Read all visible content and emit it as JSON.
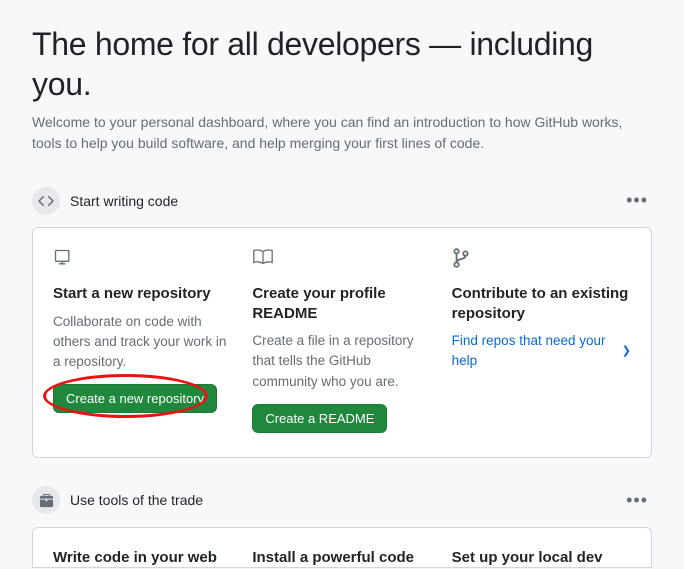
{
  "hero": {
    "title": "The home for all developers — including you.",
    "subtitle": "Welcome to your personal dashboard, where you can find an introduction to how GitHub works, tools to help you build software, and help merging your first lines of code."
  },
  "section1": {
    "title": "Start writing code",
    "cards": [
      {
        "title": "Start a new repository",
        "desc": "Collaborate on code with others and track your work in a repository.",
        "button": "Create a new repository"
      },
      {
        "title": "Create your profile README",
        "desc": "Create a file in a repository that tells the GitHub community who you are.",
        "button": "Create a README"
      },
      {
        "title": "Contribute to an existing repository",
        "link": "Find repos that need your help"
      }
    ]
  },
  "section2": {
    "title": "Use tools of the trade",
    "cards": [
      {
        "title": "Write code in your web"
      },
      {
        "title": "Install a powerful code"
      },
      {
        "title": "Set up your local dev"
      }
    ]
  }
}
